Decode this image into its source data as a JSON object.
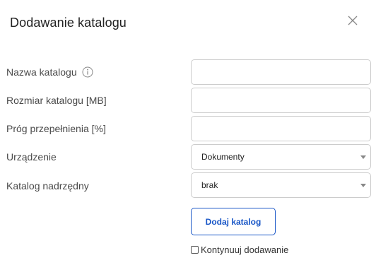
{
  "dialog": {
    "title": "Dodawanie katalogu",
    "close_icon": "close-icon"
  },
  "form": {
    "name": {
      "label": "Nazwa katalogu",
      "value": "",
      "info_icon": "info-icon"
    },
    "size": {
      "label": "Rozmiar katalogu [MB]",
      "value": ""
    },
    "threshold": {
      "label": "Próg przepełnienia [%]",
      "value": ""
    },
    "device": {
      "label": "Urządzenie",
      "selected": "Dokumenty"
    },
    "parent": {
      "label": "Katalog nadrzędny",
      "selected": "brak"
    }
  },
  "actions": {
    "submit_label": "Dodaj katalog",
    "continue_label": "Kontynuuj dodawanie",
    "continue_checked": false
  },
  "colors": {
    "accent": "#1a57c7",
    "border": "#cccccc",
    "text": "#333333"
  }
}
